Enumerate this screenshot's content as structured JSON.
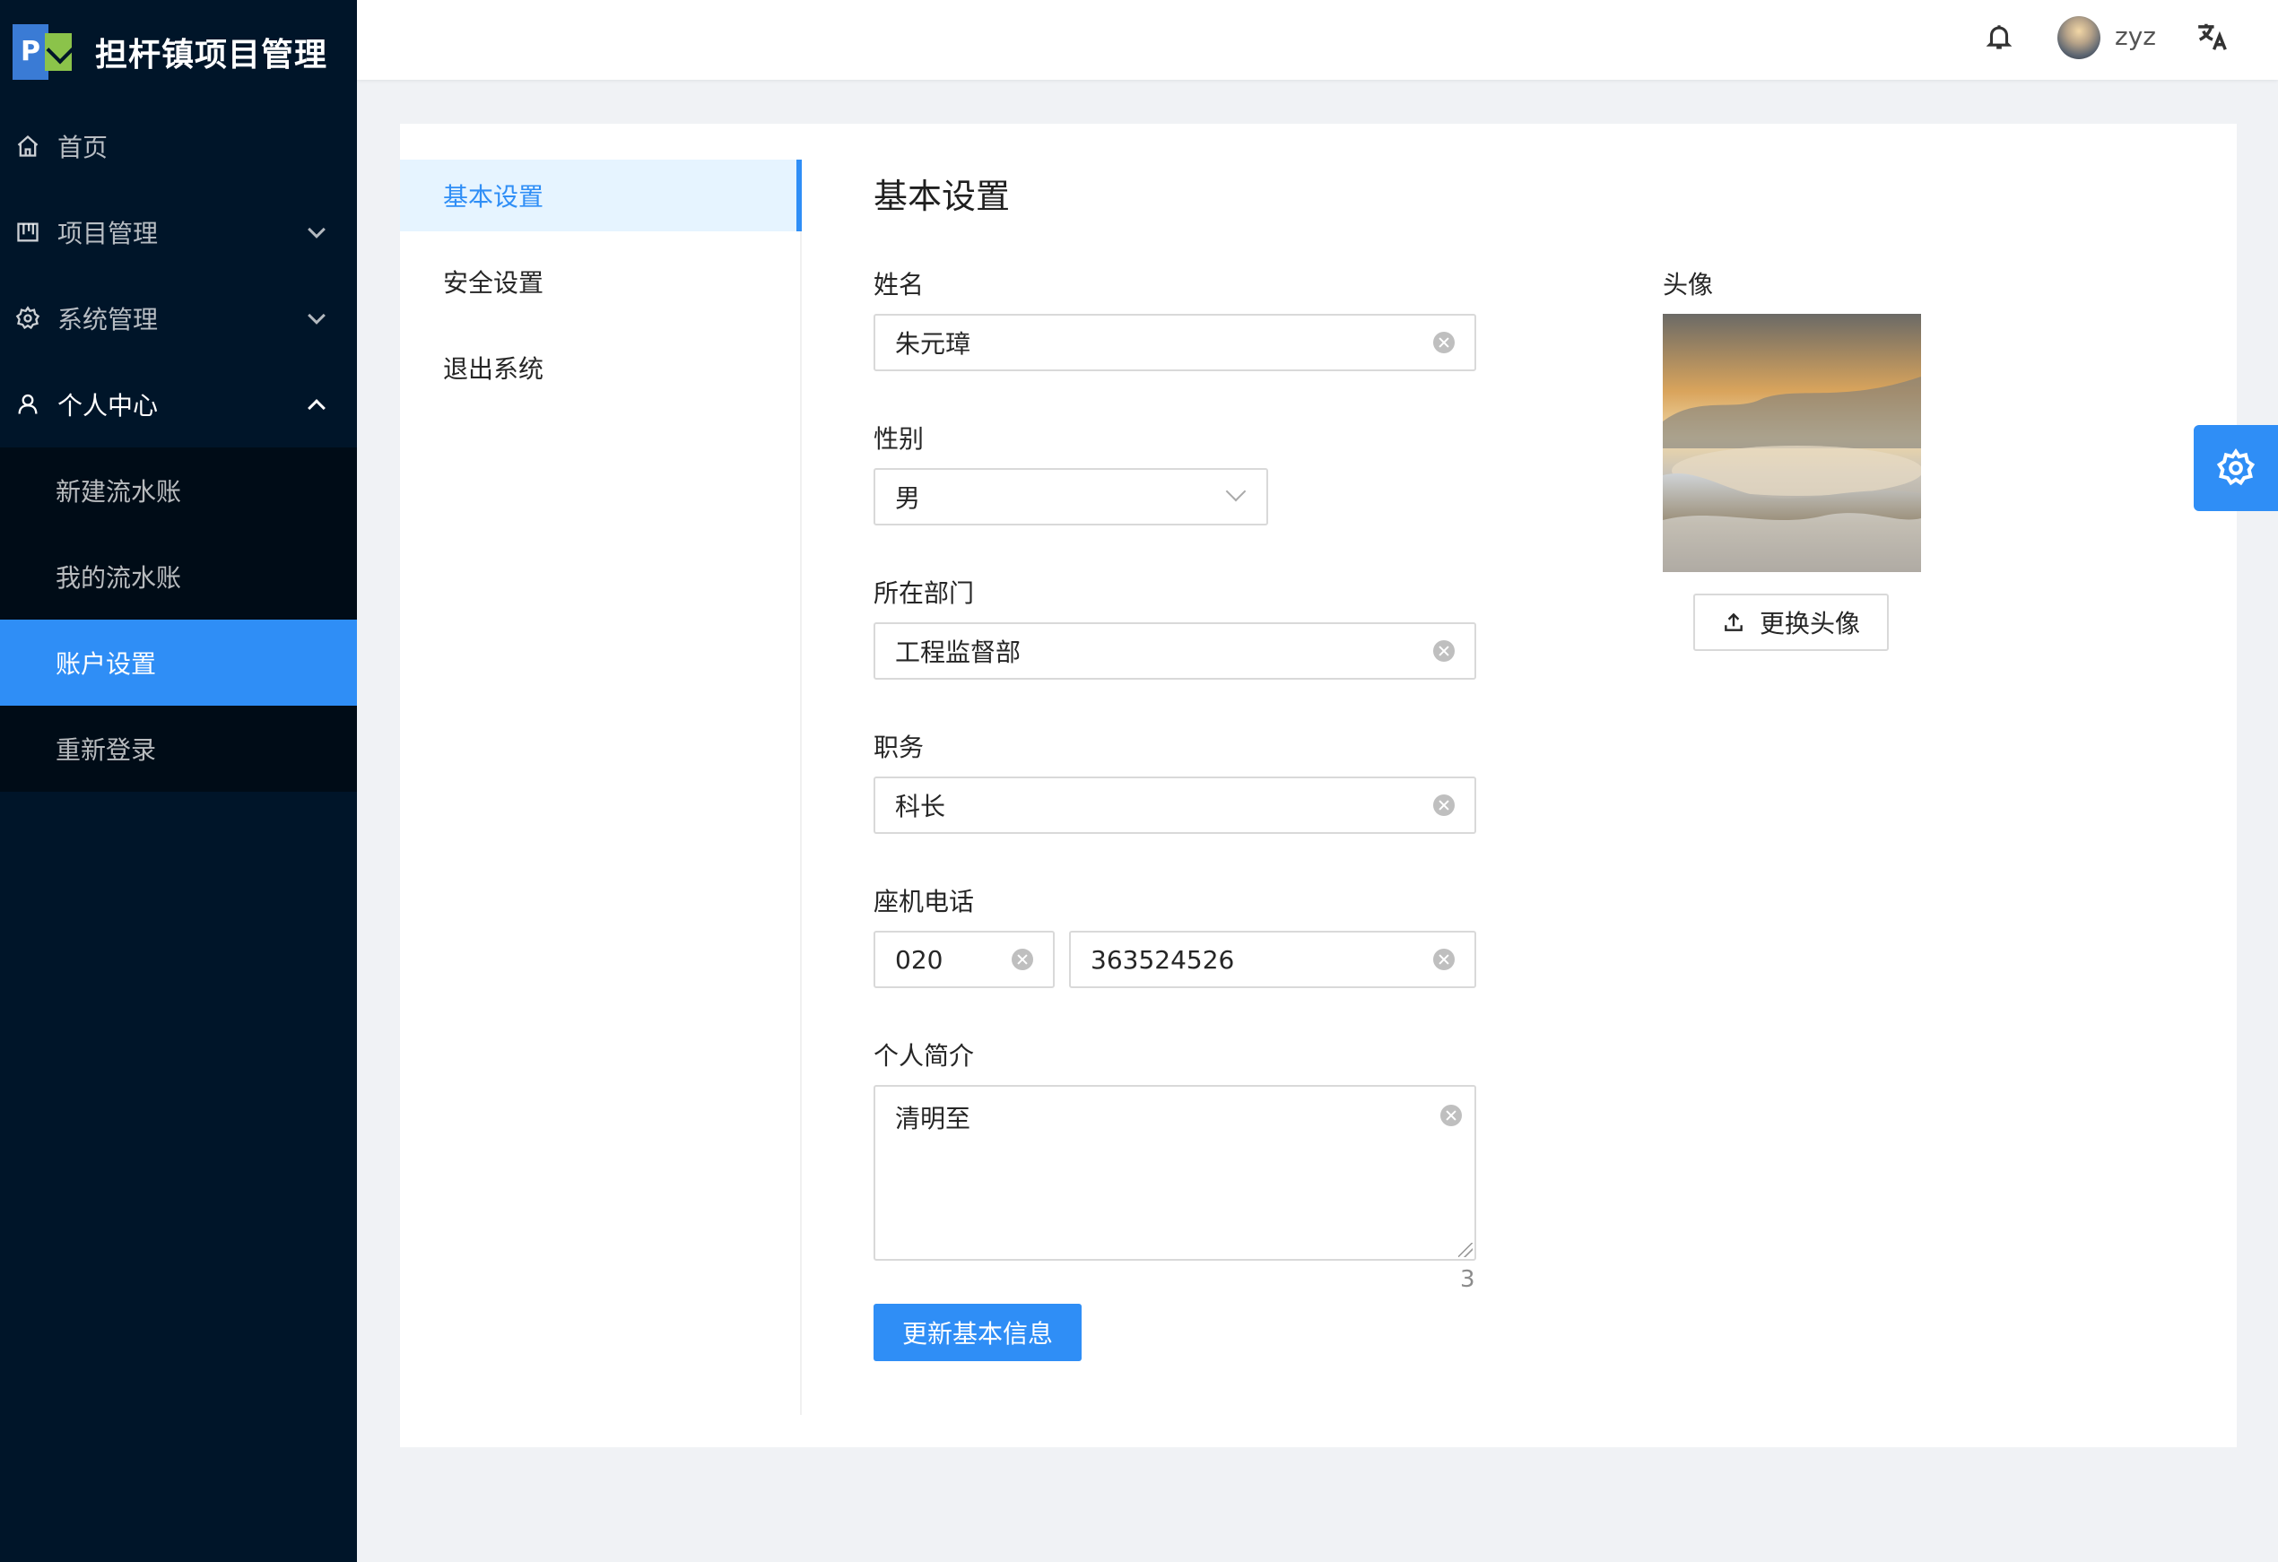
{
  "app": {
    "title": "担杆镇项目管理",
    "logo_letter": "P"
  },
  "sidebar": {
    "items": [
      {
        "label": "首页",
        "icon": "home-icon"
      },
      {
        "label": "项目管理",
        "icon": "project-icon"
      },
      {
        "label": "系统管理",
        "icon": "gear-icon"
      },
      {
        "label": "个人中心",
        "icon": "user-icon"
      }
    ],
    "personal_center_children": [
      {
        "label": "新建流水账"
      },
      {
        "label": "我的流水账"
      },
      {
        "label": "账户设置"
      },
      {
        "label": "重新登录"
      }
    ]
  },
  "header": {
    "username": "zyz"
  },
  "settings_menu": {
    "items": [
      {
        "label": "基本设置"
      },
      {
        "label": "安全设置"
      },
      {
        "label": "退出系统"
      }
    ]
  },
  "form": {
    "title": "基本设置",
    "name_label": "姓名",
    "name_value": "朱元璋",
    "gender_label": "性别",
    "gender_value": "男",
    "department_label": "所在部门",
    "department_value": "工程监督部",
    "position_label": "职务",
    "position_value": "科长",
    "phone_label": "座机电话",
    "phone_area": "020",
    "phone_number": "363524526",
    "bio_label": "个人简介",
    "bio_value": "清明至",
    "bio_count": "3",
    "submit_label": "更新基本信息"
  },
  "avatar": {
    "label": "头像",
    "change_label": "更换头像"
  },
  "colors": {
    "primary": "#2f8ef6",
    "sidebar_bg": "#001529",
    "submenu_bg": "#000c17"
  }
}
